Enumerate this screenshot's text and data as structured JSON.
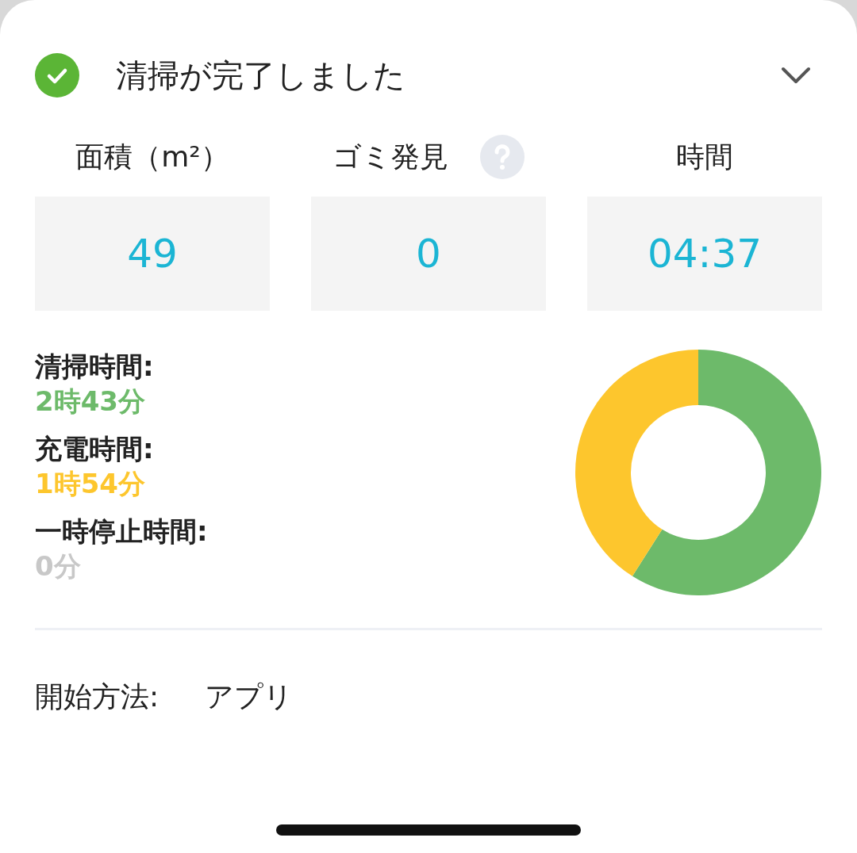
{
  "header": {
    "title": "清掃が完了しました",
    "done": true
  },
  "summary": [
    {
      "label": "面積（m²）",
      "value": "49",
      "help": false
    },
    {
      "label": "ゴミ発見",
      "value": "0",
      "help": true
    },
    {
      "label": "時間",
      "value": "04:37",
      "help": false
    }
  ],
  "breakdown": [
    {
      "label": "清掃時間:",
      "value": "2時43分",
      "color": "#6dba6a"
    },
    {
      "label": "充電時間:",
      "value": "1時54分",
      "color": "#fdc62d"
    },
    {
      "label": "一時停止時間:",
      "value": "0分",
      "color": "#c8c8c8"
    }
  ],
  "chart_data": {
    "type": "donut",
    "values": [
      59,
      41,
      0
    ]
  },
  "start": {
    "label": "開始方法:",
    "value": "アプリ"
  }
}
